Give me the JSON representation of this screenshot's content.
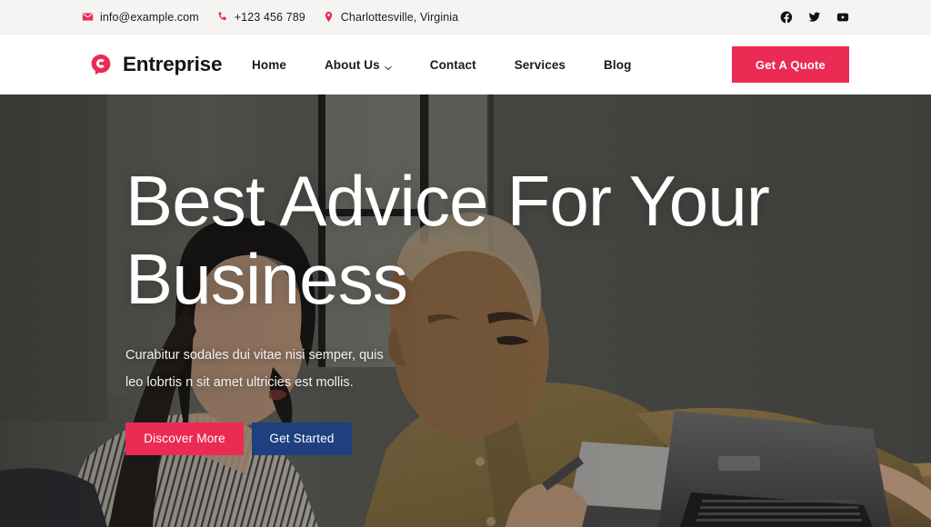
{
  "colors": {
    "accent": "#ec2b55",
    "secondary": "#1f3f7f",
    "topbar_bg": "#f6f4f2",
    "header_bg": "#ffffff",
    "text_dark": "#1a1a1a",
    "hero_text": "#ffffff"
  },
  "topbar": {
    "email": "info@example.com",
    "phone": "+123 456 789",
    "location": "Charlottesville, Virginia",
    "icons": {
      "email": "envelope-icon",
      "phone": "phone-icon",
      "location": "map-pin-icon"
    },
    "social": [
      {
        "name": "facebook-icon",
        "label": "Facebook"
      },
      {
        "name": "twitter-icon",
        "label": "Twitter"
      },
      {
        "name": "youtube-icon",
        "label": "YouTube"
      }
    ]
  },
  "header": {
    "logo_icon": "speech-bubble-c-logo-icon",
    "brand": "Entreprise",
    "nav": [
      {
        "label": "Home",
        "has_dropdown": false
      },
      {
        "label": "About Us",
        "has_dropdown": true
      },
      {
        "label": "Contact",
        "has_dropdown": false
      },
      {
        "label": "Services",
        "has_dropdown": false
      },
      {
        "label": "Blog",
        "has_dropdown": false
      }
    ],
    "cta": "Get A Quote"
  },
  "hero": {
    "title": "Best Advice For Your Business",
    "subtitle": "Curabitur sodales dui vitae nisi semper, quis leo lobrtis n sit amet ultricies est mollis.",
    "primary_button": "Discover More",
    "secondary_button": "Get Started",
    "background_description": "Two business colleagues working at a desk with laptops in a grey office"
  }
}
